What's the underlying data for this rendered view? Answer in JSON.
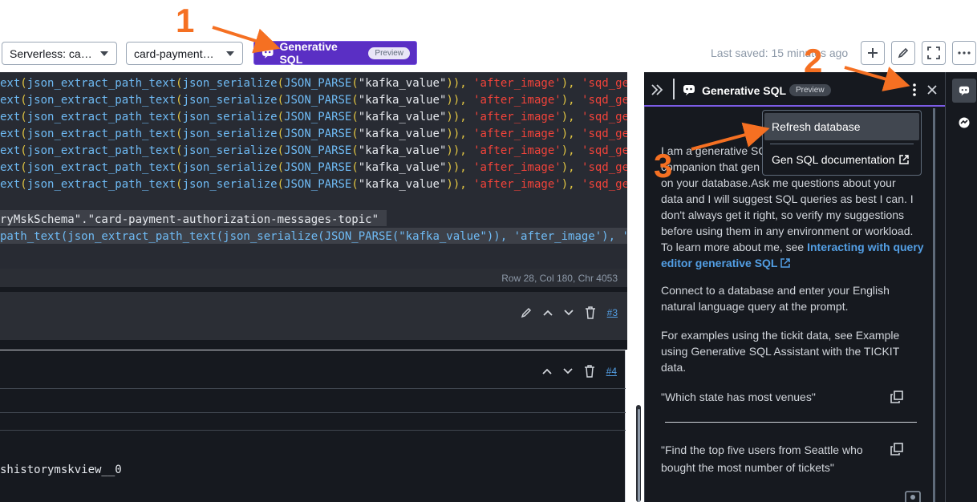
{
  "toolbar": {
    "connection": "Serverless: ca…",
    "database": "card-payment…",
    "gen_sql_label": "Generative SQL",
    "preview_badge": "Preview",
    "last_saved": "Last saved: 15 minutes ago"
  },
  "editor": {
    "line_text": "ext(json_extract_path_text(json_serialize(JSON_PARSE(\"kafka_value\")), 'after_image'), 'sqd_ge",
    "schema_line": "ryMskSchema\".\"card-payment-authorization-messages-topic\"",
    "path_line": "path_text(json_extract_path_text(json_serialize(JSON_PARSE(\"kafka_value\")), 'after_image'), '",
    "status": "Row 28,  Col 180,  Chr 4053"
  },
  "cells": {
    "cell3_number": "#3",
    "cell4_number": "#4",
    "result_text": "shistorymskview__0"
  },
  "assistant": {
    "title": "Generative SQL",
    "badge": "Preview",
    "intro_visible": "I am a generative SQ",
    "intro_line2": "companion that gen",
    "intro_line3": "on your database.Ask me questions about your",
    "intro_rest": "data and I will suggest SQL queries as best I can. I don't always get it right, so verify my suggestions before using them in any environment or workload. To learn more about me, see ",
    "learn_link": "Interacting with query editor generative SQL",
    "connect_text": "Connect to a database and enter your English natural language query at the prompt.",
    "examples_text": "For examples using the tickit data, see Example using Generative SQL Assistant with the TICKIT data.",
    "example1": "\"Which state has most venues\"",
    "example2": "\"Find the top five users from Seattle who bought the most number of tickets\""
  },
  "menu": {
    "refresh": "Refresh database",
    "gen_docs": "Gen SQL documentation"
  },
  "annotations": {
    "n1": "1",
    "n2": "2",
    "n3": "3",
    "color": "#f57022"
  }
}
